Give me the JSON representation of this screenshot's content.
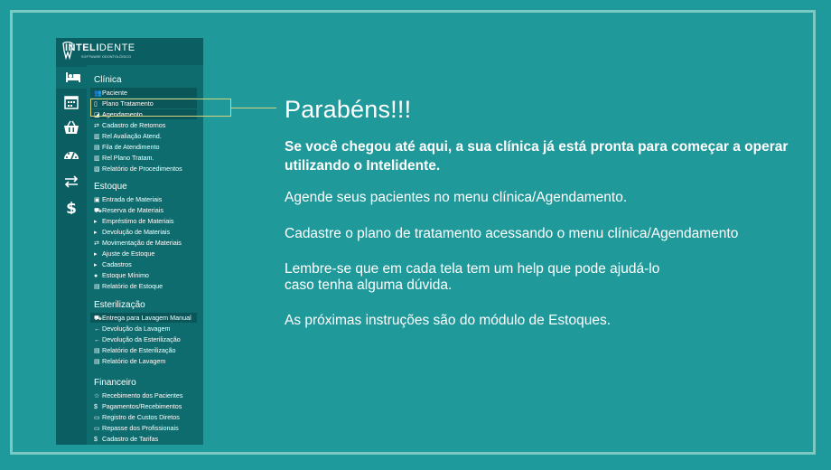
{
  "app": {
    "logo": {
      "brand_bold": "INTELI",
      "brand_thin": "DENTE",
      "tagline": "SOFTWARE ODONTOLÓGICO"
    },
    "rail": [
      {
        "icon": "bed-icon"
      },
      {
        "icon": "calendar-icon"
      },
      {
        "icon": "basket-icon"
      },
      {
        "icon": "dashboard-icon"
      },
      {
        "icon": "exchange-icon"
      },
      {
        "icon": "dollar-icon"
      }
    ],
    "sections": [
      {
        "title": "Clínica",
        "items": [
          {
            "label": "Paciente",
            "icon": "users-icon",
            "glyph": "👥"
          },
          {
            "label": "Plano Tratamento",
            "icon": "file-icon",
            "glyph": "▯"
          },
          {
            "label": "Agendamento",
            "icon": "book-icon",
            "glyph": "◪"
          },
          {
            "label": "Cadastro de Retornos",
            "icon": "exchange-icon",
            "glyph": "⇄"
          },
          {
            "label": "Rel Avaliação Atend.",
            "icon": "bar-chart-icon",
            "glyph": "▥"
          },
          {
            "label": "Fila de Atendimento",
            "icon": "copy-icon",
            "glyph": "▤"
          },
          {
            "label": "Rel Plano Tratam.",
            "icon": "chart-icon",
            "glyph": "▥"
          },
          {
            "label": "Relatório de Procedimentos",
            "icon": "report-icon",
            "glyph": "▧"
          }
        ]
      },
      {
        "title": "Estoque",
        "items": [
          {
            "label": "Entrada de Materiais",
            "icon": "save-icon",
            "glyph": "▣"
          },
          {
            "label": "Reserva de Materiais",
            "icon": "basket-icon",
            "glyph": "⛟"
          },
          {
            "label": "Empréstimo de Materiais",
            "icon": "caret-right-icon",
            "glyph": "▸"
          },
          {
            "label": "Devolução de Materiais",
            "icon": "caret-right-icon",
            "glyph": "▸"
          },
          {
            "label": "Movimentação de Materiais",
            "icon": "exchange-icon",
            "glyph": "⇄"
          },
          {
            "label": "Ajuste de Estoque",
            "icon": "caret-right-icon",
            "glyph": "▸"
          },
          {
            "label": "Cadastros",
            "icon": "caret-right-icon",
            "glyph": "▸"
          },
          {
            "label": "Estoque Mínimo",
            "icon": "alert-icon",
            "glyph": "●"
          },
          {
            "label": "Relatório de Estoque",
            "icon": "report-icon",
            "glyph": "▤"
          }
        ]
      },
      {
        "title": "Esterilização",
        "items": [
          {
            "label": "Entrega para Lavagem Manual",
            "icon": "truck-icon",
            "glyph": "⛟"
          },
          {
            "label": "Devolução da Lavagem",
            "icon": "arrow-left-icon",
            "glyph": "←"
          },
          {
            "label": "Devolução da Esterilização",
            "icon": "arrow-left-icon",
            "glyph": "←"
          },
          {
            "label": "Relatório de Esterilização",
            "icon": "report-icon",
            "glyph": "▤"
          },
          {
            "label": "Relatório de Lavagem",
            "icon": "report-icon",
            "glyph": "▤"
          }
        ]
      },
      {
        "title": "Financeiro",
        "items": [
          {
            "label": "Recebimento dos Pacientes",
            "icon": "star-icon",
            "glyph": "☆"
          },
          {
            "label": "Pagamentos/Recebimentos",
            "icon": "dollar-icon",
            "glyph": "$"
          },
          {
            "label": "Registro de Custos Diretos",
            "icon": "money-icon",
            "glyph": "▭"
          },
          {
            "label": "Repasse dos Profissionais",
            "icon": "money-icon",
            "glyph": "▭"
          },
          {
            "label": "Cadastro de Tarifas",
            "icon": "dollar-icon",
            "glyph": "$"
          }
        ]
      }
    ]
  },
  "content": {
    "heading": "Parabéns!!!",
    "lead": "Se você chegou até aqui, a sua clínica já está pronta para começar a operar utilizando o Intelidente.",
    "p1": "Agende seus pacientes no menu clínica/Agendamento.",
    "p2": "Cadastre o plano de tratamento acessando o menu clínica/Agendamento",
    "p3a": "Lembre-se que em cada tela tem um help que pode ajudá-lo",
    "p3b": "caso tenha alguma dúvida.",
    "p4": "As próximas instruções são do módulo de Estoques."
  },
  "colors": {
    "background": "#1f9a9c",
    "frame_border": "#7cc9c4",
    "sidebar": "#0e6c6f",
    "rail": "#0b5f62",
    "callout": "#d8d27a"
  }
}
